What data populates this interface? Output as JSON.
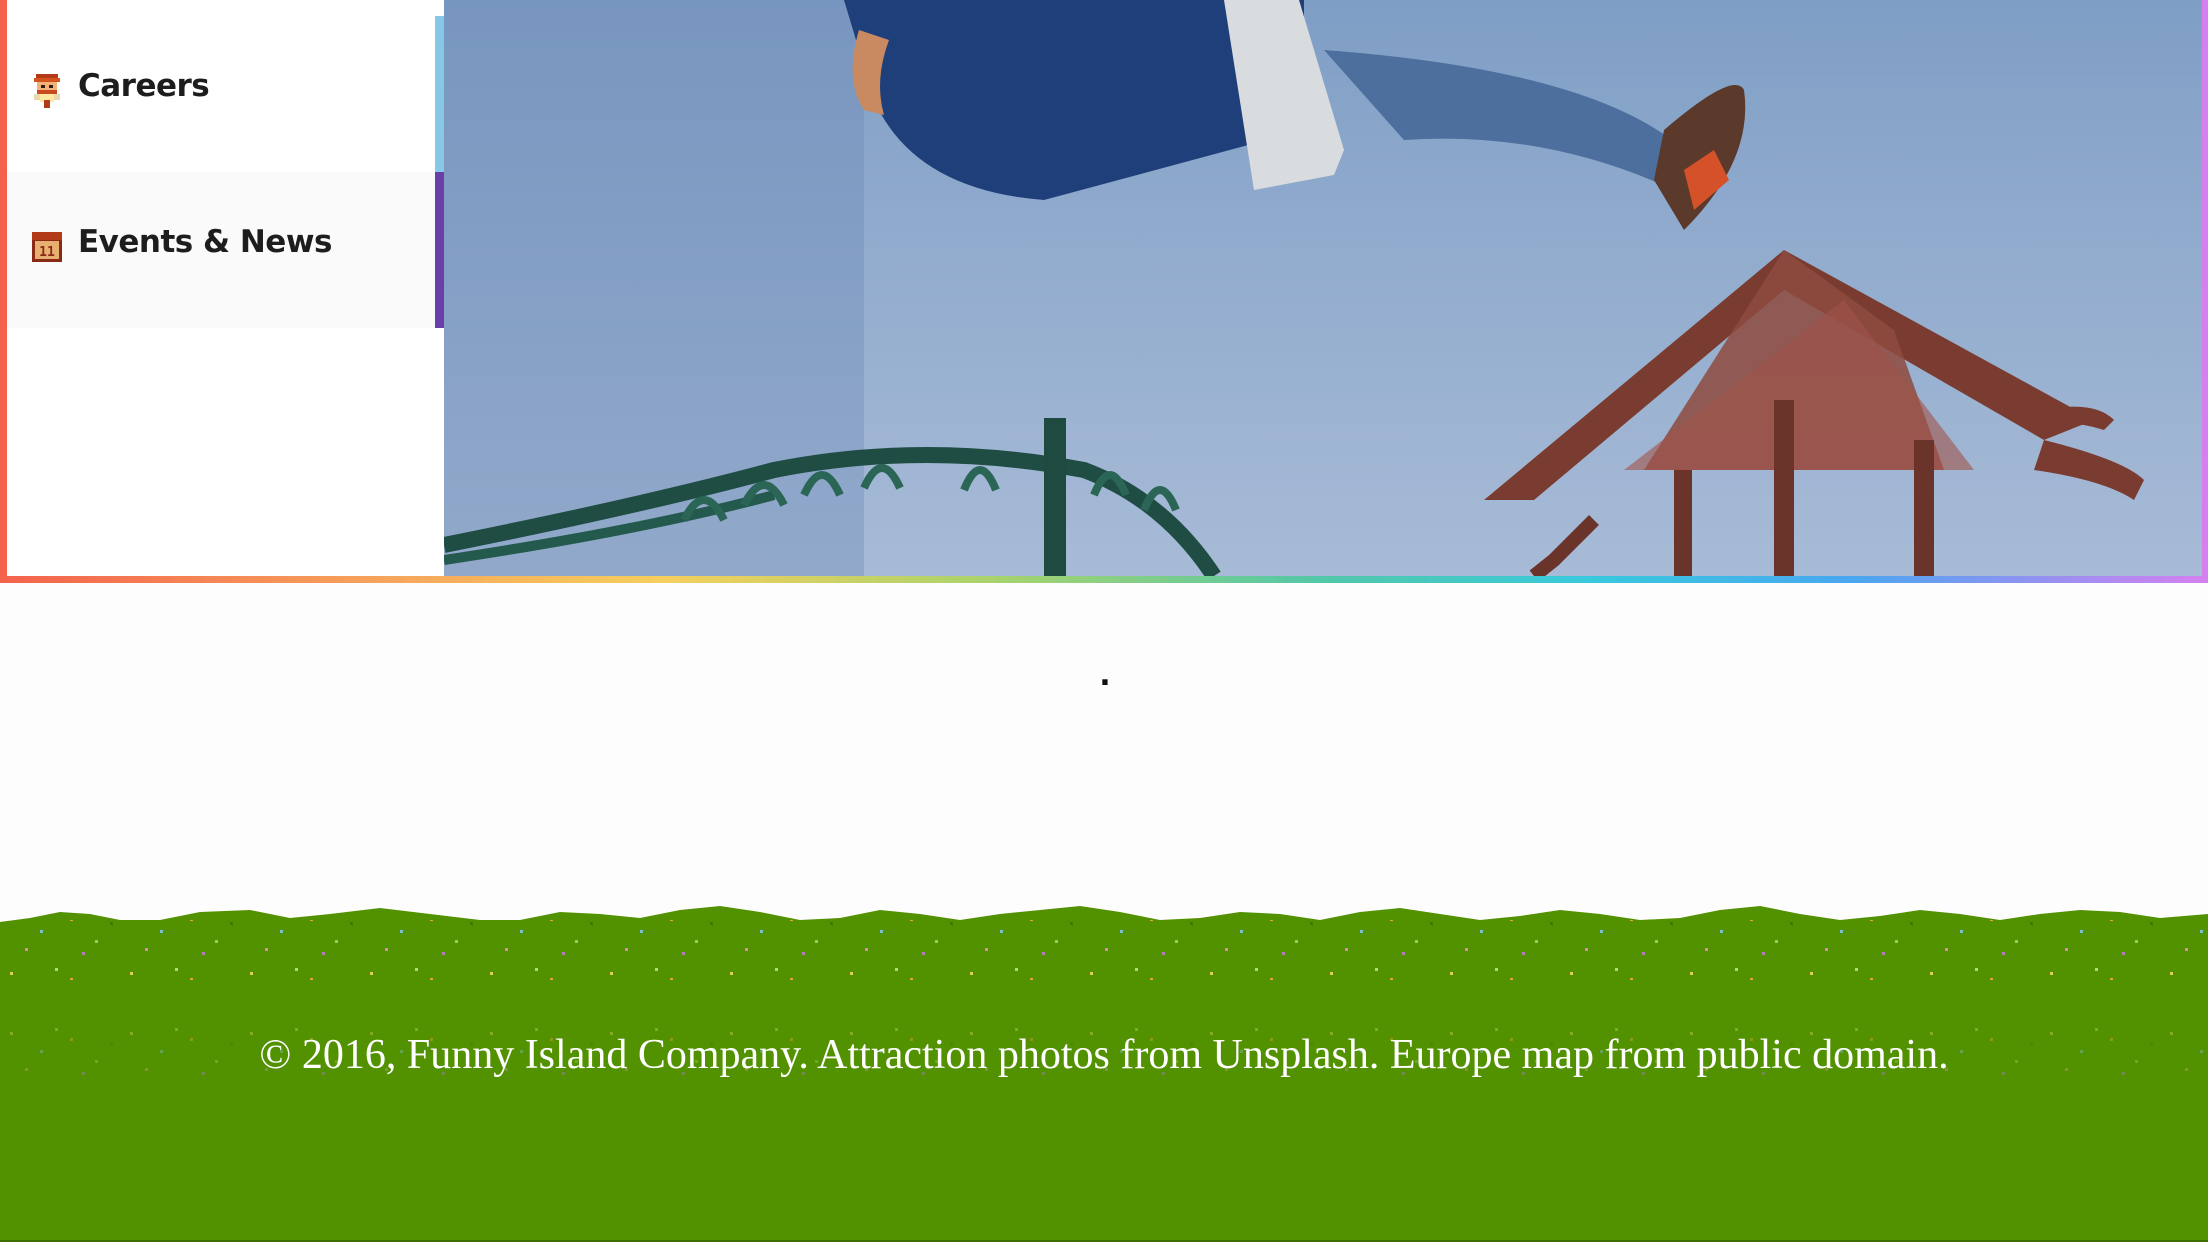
{
  "menu": {
    "items": [
      {
        "label": "Careers",
        "icon": "person-icon",
        "accent": "#86c8e6"
      },
      {
        "label": "Events & News",
        "icon": "calendar-icon",
        "icon_text": "11",
        "accent": "#6b3fa7"
      }
    ]
  },
  "hero": {
    "image": "attraction-photo-person-on-swing"
  },
  "main": {
    "text": "."
  },
  "footer": {
    "copyright": "© 2016, Funny Island Company. Attraction photos from Unsplash. Europe map from public domain.",
    "grass_color": "#529100"
  },
  "colors": {
    "rainbow": [
      "#f4624d",
      "#f6a65c",
      "#f5cf5d",
      "#a8d36e",
      "#52c7a9",
      "#38c9dd",
      "#4aa6f0",
      "#d67ff0"
    ]
  }
}
